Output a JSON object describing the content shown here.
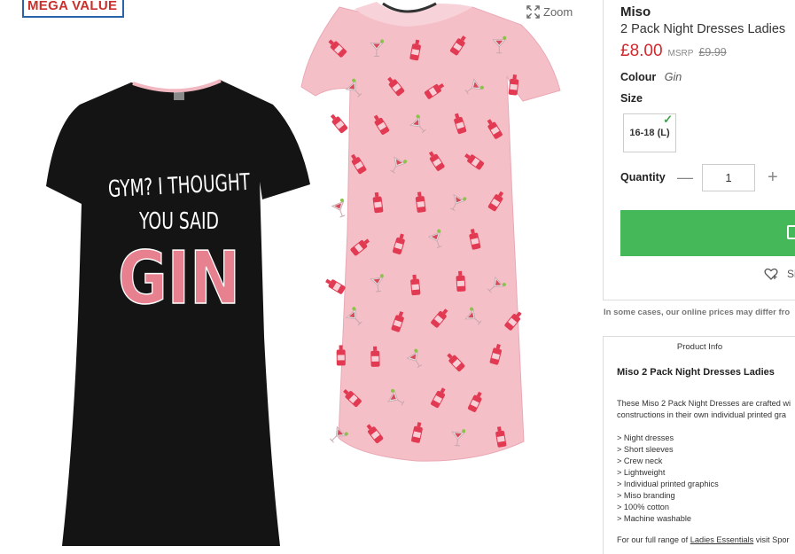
{
  "badge": "MEGA VALUE",
  "zoom_label": "Zoom",
  "dress_front": {
    "line1": "GYM? I THOUGHT",
    "line2": "YOU SAID",
    "line3": "GIN"
  },
  "product": {
    "brand": "Miso",
    "name": "2 Pack Night Dresses Ladies",
    "price": "£8.00",
    "msrp_label": "MSRP",
    "msrp_value": "£9.99",
    "colour_label": "Colour",
    "colour_value": "Gin",
    "size_label": "Size",
    "size_option": "16-18 (L)",
    "quantity_label": "Quantity",
    "quantity_value": "1",
    "wishlist_label": "Sig"
  },
  "disclaimer": "In some cases, our online prices may differ fro",
  "info": {
    "heading": "Product Info",
    "title": "Miso 2 Pack Night Dresses Ladies",
    "desc_line1": "These Miso 2 Pack Night Dresses are crafted wi",
    "desc_line2": "constructions in their own individual printed gra",
    "features": [
      "> Night dresses",
      "> Short sleeves",
      "> Crew neck",
      "> Lightweight",
      "> Individual printed graphics",
      "> Miso branding",
      "> 100% cotton",
      "> Machine washable"
    ],
    "footer_prefix": "For our full range of ",
    "footer_link": "Ladies Essentials",
    "footer_suffix": " visit Spor"
  },
  "colors": {
    "price_red": "#d0282e",
    "add_to_bag_green": "#45b85a",
    "badge_blue": "#2a64a8",
    "black_dress": "#141414",
    "pink_dress": "#f5bfc8",
    "gin_pink": "#e8818f"
  }
}
